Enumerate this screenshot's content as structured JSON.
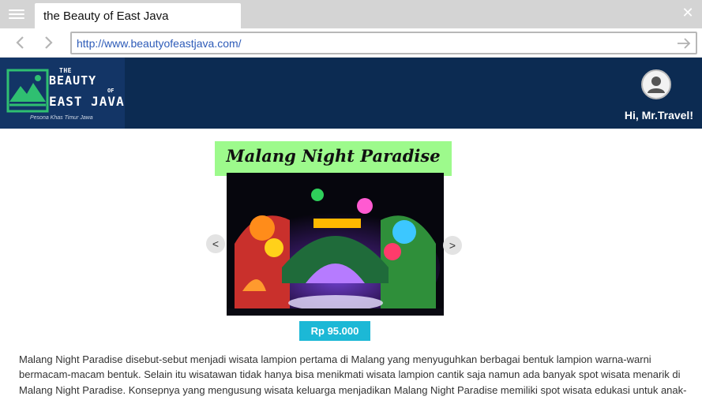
{
  "browser": {
    "tab_title": "the Beauty of East Java",
    "url": "http://www.beautyofeastjava.com/"
  },
  "site": {
    "logo": {
      "the": "THE",
      "beauty": "BEAUTY",
      "of": "OF",
      "east_java": "EAST JAVA",
      "tagline": "Pesona Khas Timur Jawa"
    },
    "greeting": "Hi, Mr.Travel!"
  },
  "attraction": {
    "title": "Malang Night Paradise",
    "price": "Rp 95.000",
    "prev_label": "<",
    "next_label": ">",
    "description": "Malang Night Paradise disebut-sebut menjadi wisata lampion pertama di Malang yang menyuguhkan berbagai bentuk lampion warna-warni bermacam-macam bentuk. Selain itu wisatawan tidak hanya bisa menikmati wisata lampion cantik saja namun ada banyak spot wisata menarik di Malang Night Paradise. Konsepnya yang mengusung wisata keluarga menjadikan Malang Night Paradise memiliki spot wisata edukasi untuk anak-anak seperti Taman Dinosaurus yang menampilkan replika binatang purba."
  },
  "icons": {
    "menu": "hamburger-icon",
    "close": "close-icon",
    "back": "arrow-left-icon",
    "forward": "arrow-right-icon",
    "go": "go-arrow-icon",
    "user": "user-icon"
  },
  "colors": {
    "header_bg": "#0c2b52",
    "title_bg": "#9dfa8c",
    "price_bg": "#1cb8d6",
    "logo_green": "#2fbf71"
  }
}
